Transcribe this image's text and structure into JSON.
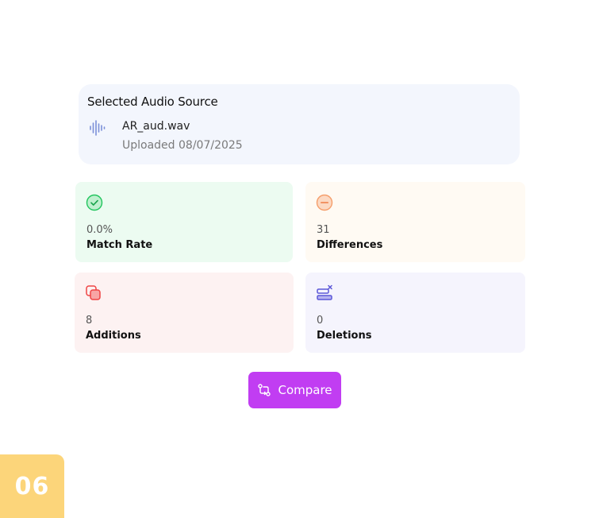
{
  "source": {
    "title": "Selected Audio Source",
    "file_name": "AR_aud.wav",
    "uploaded": "Uploaded 08/07/2025",
    "icon": "audio-wave-icon"
  },
  "stats": {
    "match": {
      "value": "0.0%",
      "label": "Match Rate",
      "icon": "check-circle-icon",
      "color": "#22c55e"
    },
    "differences": {
      "value": "31",
      "label": "Differences",
      "icon": "minus-circle-icon",
      "color": "#f59e6b"
    },
    "additions": {
      "value": "8",
      "label": "Additions",
      "icon": "copy-plus-icon",
      "color": "#ef4444"
    },
    "deletions": {
      "value": "0",
      "label": "Deletions",
      "icon": "remove-list-icon",
      "color": "#5b57d8"
    }
  },
  "compare": {
    "label": "Compare",
    "icon": "git-compare-icon",
    "color": "#c13df2"
  },
  "step": {
    "number": "06",
    "color": "#fcd57a"
  }
}
